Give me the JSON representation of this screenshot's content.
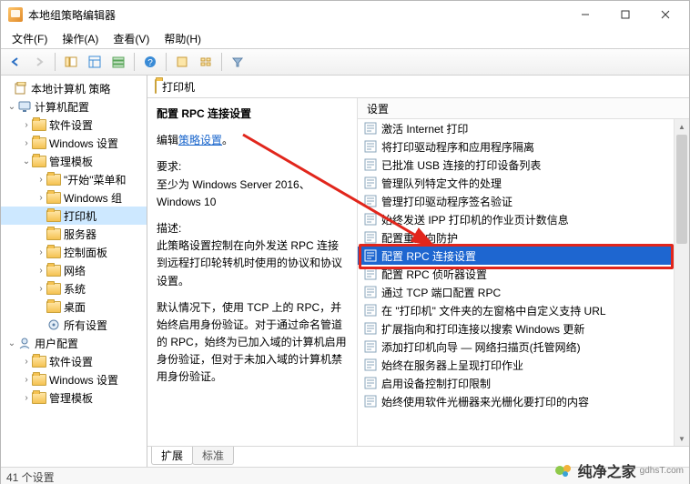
{
  "title": "本地组策略编辑器",
  "menus": {
    "file": "文件(F)",
    "action": "操作(A)",
    "view": "查看(V)",
    "help": "帮助(H)"
  },
  "tree": {
    "root": "本地计算机 策略",
    "computer_config": "计算机配置",
    "software_settings": "软件设置",
    "windows_settings": "Windows 设置",
    "admin_templates": "管理模板",
    "start_menu": "\"开始\"菜单和",
    "windows_components": "Windows 组",
    "printers": "打印机",
    "servers": "服务器",
    "control_panel": "控制面板",
    "network": "网络",
    "system": "系统",
    "desktop": "桌面",
    "all_settings": "所有设置",
    "user_config": "用户配置",
    "u_software_settings": "软件设置",
    "u_windows_settings": "Windows 设置",
    "u_admin_templates": "管理模板"
  },
  "right_header": "打印机",
  "desc": {
    "title": "配置 RPC 连接设置",
    "edit_prefix": "编辑",
    "edit_link": "策略设置",
    "req_label": "要求:",
    "req_text": "至少为 Windows Server 2016、Windows 10",
    "desc_label": "描述:",
    "desc_p1": "此策略设置控制在向外发送 RPC 连接到远程打印轮转机时使用的协议和协议设置。",
    "desc_p2": "默认情况下，使用 TCP 上的 RPC，并始终启用身份验证。对于通过命名管道的 RPC，始终为已加入域的计算机启用身份验证，但对于未加入域的计算机禁用身份验证。"
  },
  "list_header": "设置",
  "settings": [
    "激活 Internet 打印",
    "将打印驱动程序和应用程序隔离",
    "已批准 USB 连接的打印设备列表",
    "管理队列特定文件的处理",
    "管理打印驱动程序签名验证",
    "始终发送 IPP 打印机的作业页计数信息",
    "配置重定向防护",
    "配置 RPC 连接设置",
    "配置 RPC 侦听器设置",
    "通过 TCP 端口配置 RPC",
    "在 \"打印机\" 文件夹的左窗格中自定义支持 URL",
    "扩展指向和打印连接以搜索 Windows 更新",
    "添加打印机向导 — 网络扫描页(托管网络)",
    "始终在服务器上呈现打印作业",
    "启用设备控制打印限制",
    "始终使用软件光栅器来光栅化要打印的内容"
  ],
  "selected_setting_index": 7,
  "tabs": {
    "extended": "扩展",
    "standard": "标准"
  },
  "status": "41 个设置",
  "watermark": {
    "brand": "纯净之家",
    "url": "gdhsT.com"
  }
}
